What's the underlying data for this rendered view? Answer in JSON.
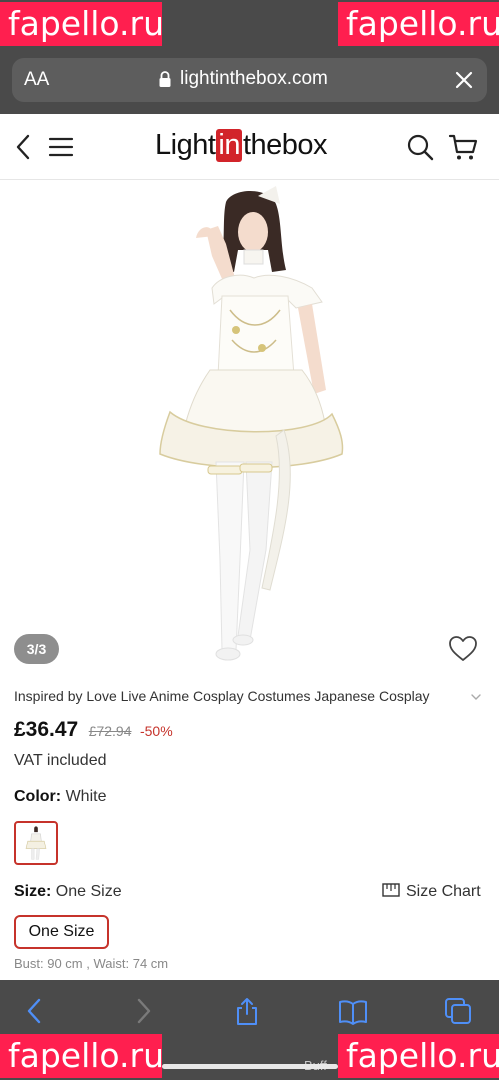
{
  "watermark": "fapello.ru",
  "status_bar": {
    "signal": "●●●●"
  },
  "browser": {
    "text_size_label": "AA",
    "url": "lightinthebox.com"
  },
  "site": {
    "logo_prefix": "Light",
    "logo_highlight": "in",
    "logo_suffix": "thebox"
  },
  "gallery": {
    "counter": "3/3"
  },
  "product": {
    "title": "Inspired by Love Live Anime Cosplay Costumes Japanese Cosplay",
    "price": "£36.47",
    "old_price": "£72.94",
    "discount": "-50%",
    "vat": "VAT included",
    "color_label": "Color:",
    "color_value": "White",
    "size_label": "Size:",
    "size_value": "One Size",
    "size_chart_label": "Size Chart",
    "size_option": "One Size",
    "measurements": "Bust: 90 cm , Waist: 74 cm"
  },
  "bottom": {
    "partial_text": "Buff"
  },
  "colors": {
    "accent": "#c6332b",
    "logo_red": "#d2242a",
    "browser_chrome": "#4a4a4a",
    "toolbar_icon": "#4f8ff7",
    "watermark": "#ff1f4f"
  },
  "icons": [
    "lock-icon",
    "close-icon",
    "back-chevron-icon",
    "menu-icon",
    "search-icon",
    "cart-icon",
    "heart-icon",
    "ruler-icon",
    "share-icon",
    "bookmarks-icon",
    "tabs-icon"
  ]
}
